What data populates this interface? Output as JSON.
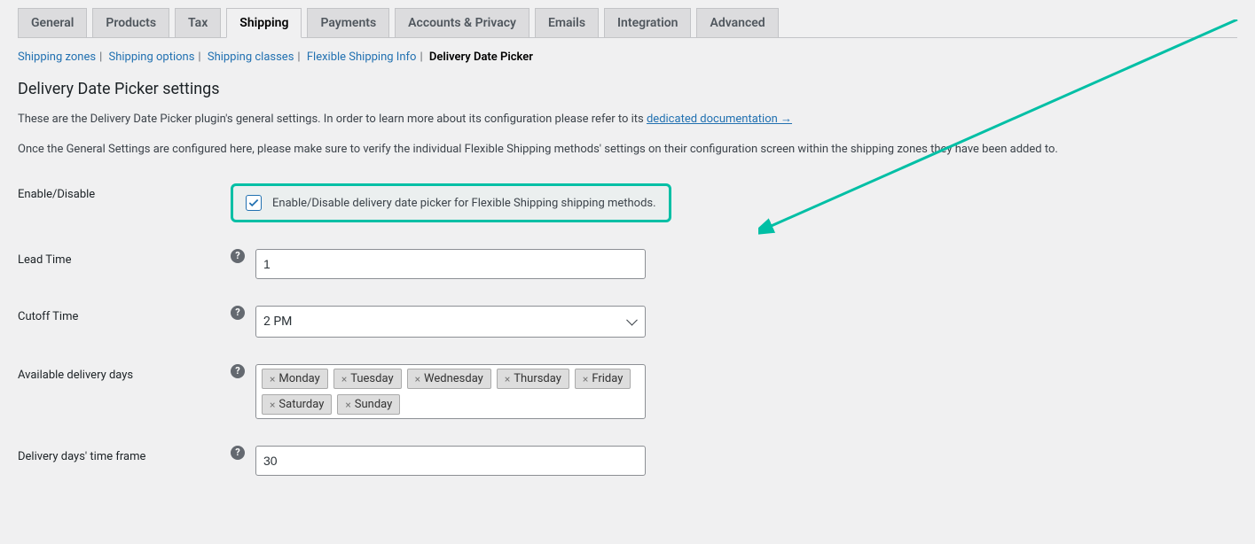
{
  "tabs": {
    "general": "General",
    "products": "Products",
    "tax": "Tax",
    "shipping": "Shipping",
    "payments": "Payments",
    "accounts": "Accounts & Privacy",
    "emails": "Emails",
    "integration": "Integration",
    "advanced": "Advanced"
  },
  "subtabs": {
    "zones": "Shipping zones",
    "options": "Shipping options",
    "classes": "Shipping classes",
    "fsinfo": "Flexible Shipping Info",
    "ddp": "Delivery Date Picker"
  },
  "page_title": "Delivery Date Picker settings",
  "desc1_a": "These are the Delivery Date Picker plugin's general settings. In order to learn more about its configuration please refer to its ",
  "desc1_link": "dedicated documentation →",
  "desc2": "Once the General Settings are configured here, please make sure to verify the individual Flexible Shipping methods' settings on their configuration screen within the shipping zones they have been added to.",
  "fields": {
    "enable_label": "Enable/Disable",
    "enable_text": "Enable/Disable delivery date picker for Flexible Shipping shipping methods.",
    "lead_label": "Lead Time",
    "lead_value": "1",
    "cutoff_label": "Cutoff Time",
    "cutoff_value": "2 PM",
    "avail_label": "Available delivery days",
    "days": [
      "Monday",
      "Tuesday",
      "Wednesday",
      "Thursday",
      "Friday",
      "Saturday",
      "Sunday"
    ],
    "frame_label": "Delivery days' time frame",
    "frame_value": "30"
  },
  "help": "?"
}
